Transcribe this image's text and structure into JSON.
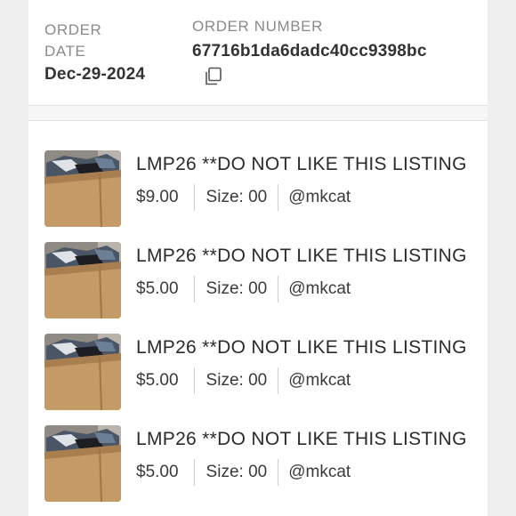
{
  "order": {
    "date_label": "ORDER DATE",
    "date_value": "Dec-29-2024",
    "number_label": "ORDER NUMBER",
    "number_value": "67716b1da6dadc40cc9398bc",
    "copy_icon": "copy-icon"
  },
  "items": [
    {
      "title": "LMP26 **DO NOT LIKE THIS LISTING",
      "price": "$9.00",
      "size": "Size: 00",
      "seller": "@mkcat"
    },
    {
      "title": "LMP26 **DO NOT LIKE THIS LISTING",
      "price": "$5.00",
      "size": "Size: 00",
      "seller": "@mkcat"
    },
    {
      "title": "LMP26 **DO NOT LIKE THIS LISTING",
      "price": "$5.00",
      "size": "Size: 00",
      "seller": "@mkcat"
    },
    {
      "title": "LMP26 **DO NOT LIKE THIS LISTING",
      "price": "$5.00",
      "size": "Size: 00",
      "seller": "@mkcat"
    }
  ]
}
